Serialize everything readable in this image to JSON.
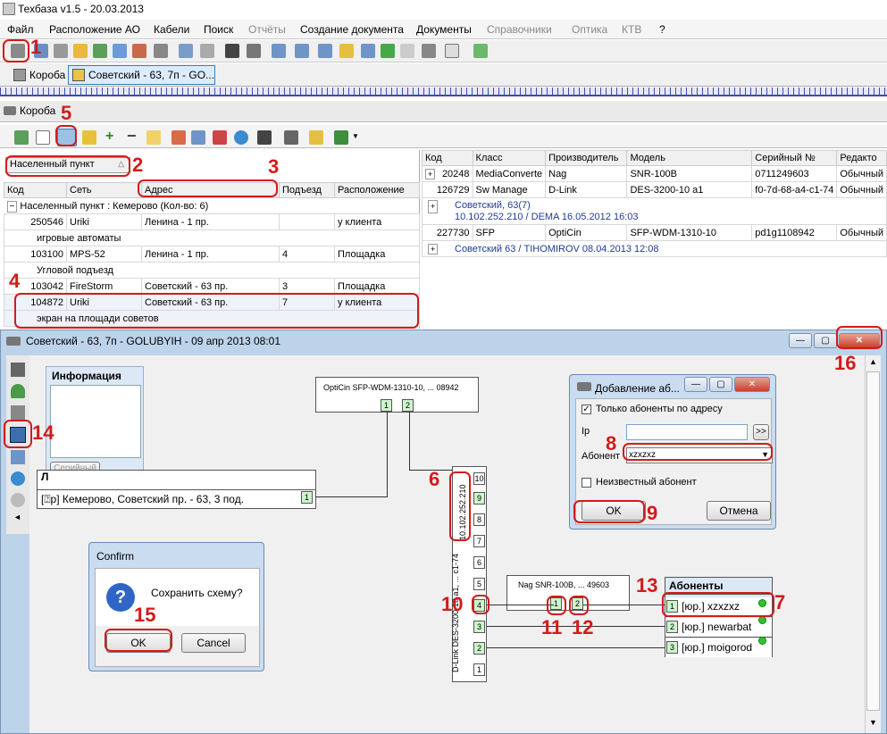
{
  "app": {
    "title": "Техбаза v1.5 - 20.03.2013"
  },
  "menu": [
    "Файл",
    "Расположение АО",
    "Кабели",
    "Поиск",
    "Отчёты",
    "Создание документа",
    "Документы",
    "Справочники",
    "Оптика",
    "КТВ",
    "?"
  ],
  "tabs": [
    {
      "label": "Короба"
    },
    {
      "label": "Советский - 63, 7п - GO..."
    }
  ],
  "panel": {
    "title": "Короба"
  },
  "left_grid": {
    "group_field": "Населенный пункт",
    "columns": [
      "Код",
      "Сеть",
      "Адрес",
      "Подъезд",
      "Расположение"
    ],
    "group_label": "Населенный пункт : Кемерово (Кол-во: 6)",
    "rows": [
      {
        "code": "250546",
        "net": "Uriki",
        "addr": "Ленина - 1 пр.",
        "entr": "",
        "loc": "у клиента",
        "note": "игровые автоматы"
      },
      {
        "code": "103100",
        "net": "MPS-52",
        "addr": "Ленина - 1 пр.",
        "entr": "4",
        "loc": "Площадка",
        "note": "Угловой подъезд"
      },
      {
        "code": "103042",
        "net": "FireStorm",
        "addr": "Советский - 63 пр.",
        "entr": "3",
        "loc": "Площадка",
        "note": ""
      },
      {
        "code": "104872",
        "net": "Uriki",
        "addr": "Советский - 63 пр.",
        "entr": "7",
        "loc": "у клиента",
        "note": "экран на площади советов"
      }
    ]
  },
  "right_grid": {
    "columns": [
      "Код",
      "Класс",
      "Производитель",
      "Модель",
      "Серийный №",
      "Редакто"
    ],
    "rows": [
      {
        "code": "20248",
        "cls": "MediaConverte",
        "mfr": "Nag",
        "model": "SNR-100B",
        "serial": "0711249603",
        "ed": "Обычный",
        "notes": []
      },
      {
        "code": "126729",
        "cls": "Sw Manage",
        "mfr": "D-Link",
        "model": "DES-3200-10 a1",
        "serial": "f0-7d-68-a4-c1-74",
        "ed": "Обычный",
        "notes": [
          "Советский, 63(7)",
          "10.102.252.210 / DEMA 16.05.2012 16:03"
        ]
      },
      {
        "code": "227730",
        "cls": "SFP",
        "mfr": "OptiCin",
        "model": "SFP-WDM-1310-10",
        "serial": "pd1g1108942",
        "ed": "Обычный",
        "notes": [
          "Советский 63 / TIHOMIROV 08.04.2013 12:08"
        ]
      }
    ]
  },
  "scheme": {
    "title": "Советский - 63, 7п - GOLUBYIH - 09 апр 2013 08:01",
    "info_title": "Информация",
    "serial_btn": "Серийный",
    "address_box": "[⍰р] Кемерово, Советский пр. - 63, 3 под.",
    "sfp_label": "OptiCin SFP-WDM-1310-10, ... 08942",
    "switch_label": "D-Link DES-3200-10 a1, ... c1-74",
    "switch_ip": "10.102.252.210",
    "switch_ports": [
      "10",
      "9",
      "8",
      "7",
      "6",
      "5",
      "4",
      "3",
      "2",
      "1"
    ],
    "nag_label": "Nag SNR-100B, ... 49603",
    "subs_title": "Абоненты",
    "subscribers": [
      {
        "num": "1",
        "name": "[юр.] xzxzxz"
      },
      {
        "num": "2",
        "name": "[юр.] newarbat"
      },
      {
        "num": "3",
        "name": "[юр.] moigorod"
      }
    ]
  },
  "add_dialog": {
    "title": "Добавление аб...",
    "only_addr": "Только абоненты по адресу",
    "ip_label": "Ip",
    "abonent_label": "Абонент",
    "abonent_value": "xzxzxz",
    "unknown": "Неизвестный абонент",
    "ok": "OK",
    "cancel": "Отмена"
  },
  "confirm": {
    "title": "Confirm",
    "message": "Сохранить схему?",
    "ok": "OK",
    "cancel": "Cancel"
  },
  "markers": [
    "1",
    "2",
    "3",
    "4",
    "5",
    "6",
    "7",
    "8",
    "9",
    "10",
    "11",
    "12",
    "13",
    "14",
    "15",
    "16"
  ]
}
